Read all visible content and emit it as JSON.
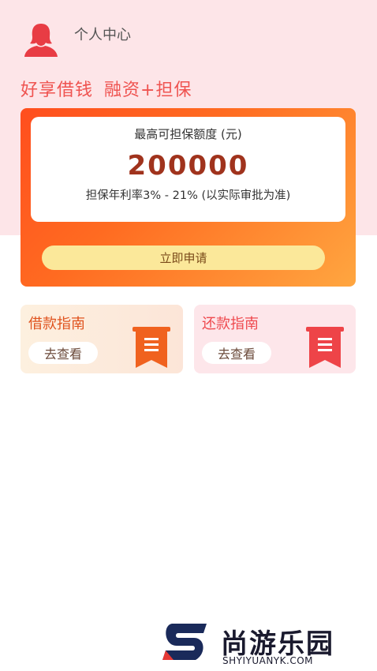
{
  "header": {
    "title": "个人中心"
  },
  "slogan": {
    "part1": "好享借钱",
    "part2": "融资+担保"
  },
  "quota_card": {
    "label": "最高可担保额度 (元)",
    "amount": "200000",
    "rate": "担保年利率3% - 21% (以实际审批为准)",
    "apply_label": "立即申请"
  },
  "guides": {
    "borrow": {
      "title": "借款指南",
      "button": "去查看"
    },
    "repay": {
      "title": "还款指南",
      "button": "去查看"
    }
  },
  "watermark": {
    "name": "尚游乐园",
    "domain": "SHYIYUANYK.COM"
  },
  "colors": {
    "accent": "#ef5350",
    "card_orange": "#ff6b21",
    "button_yellow": "#fbe89a"
  }
}
